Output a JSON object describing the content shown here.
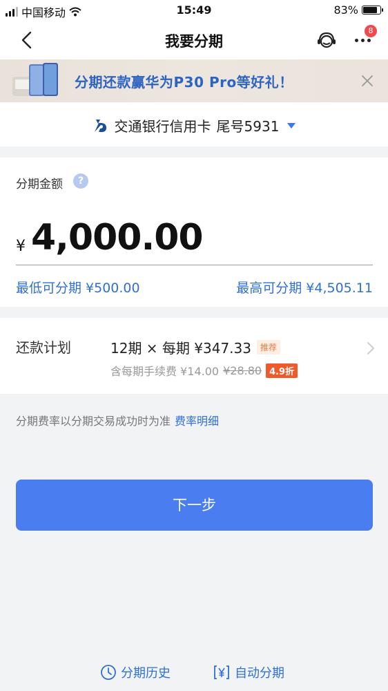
{
  "status_bar": {
    "carrier": "中国移动",
    "time": "15:49",
    "battery": "83%",
    "battery_level": 0.83
  },
  "nav": {
    "title": "我要分期",
    "more_badge": "8",
    "icons": [
      "back-icon",
      "customer-service-icon",
      "more-icon"
    ]
  },
  "banner": {
    "text": "分期还款赢华为P30 Pro等好礼！"
  },
  "card": {
    "bank_name": "交通银行信用卡",
    "card_tail": "尾号5931"
  },
  "amount": {
    "label": "分期金额",
    "help_icon": "?",
    "currency": "¥",
    "value": "4,000.00",
    "min": "最低可分期 ¥500.00",
    "max": "最高可分期 ¥4,505.11"
  },
  "plan": {
    "label": "还款计划",
    "summary": "12期 × 每期 ¥347.33",
    "tag": "推荐",
    "fee_prefix": "含每期手续费 ¥14.00",
    "fee_original": "¥28.80",
    "discount": "4.9折"
  },
  "note": {
    "text": "分期费率以分期交易成功时为准",
    "link": "费率明细"
  },
  "next_button": "下一步",
  "footer": {
    "history": "分期历史",
    "auto": "自动分期"
  },
  "colors": {
    "accent": "#4a7df0",
    "link": "#2f6fd8",
    "discount": "#f05a2b",
    "badge": "#f0494e"
  }
}
